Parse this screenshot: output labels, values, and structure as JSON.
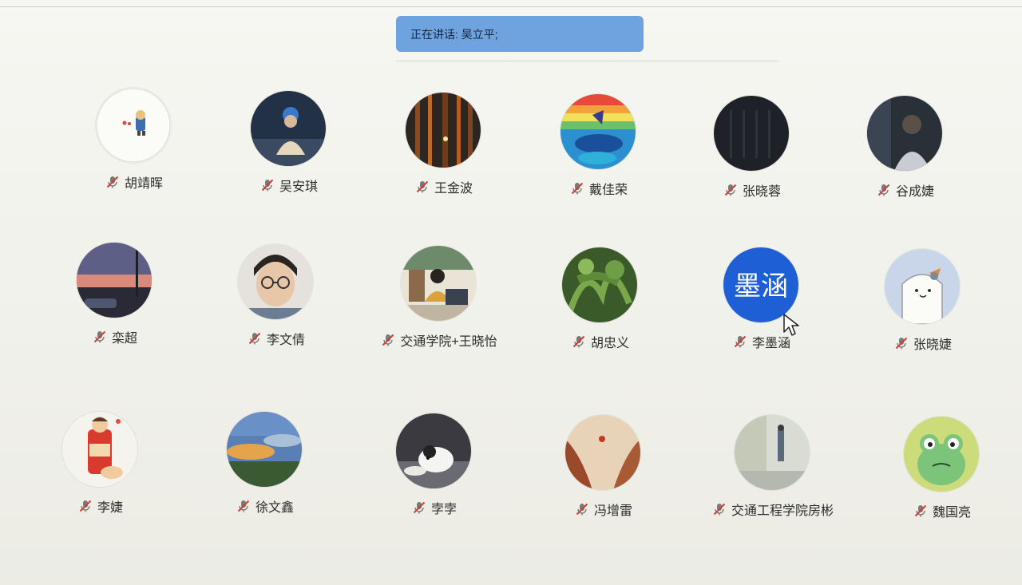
{
  "speaker_banner": {
    "text": "正在讲话: 吴立平;"
  },
  "participants": [
    {
      "name": "胡靖晖",
      "avatar_icon": "sticker-avatar",
      "mic_icon": "mic-off-icon"
    },
    {
      "name": "吴安琪",
      "avatar_icon": "photo-person-avatar",
      "mic_icon": "mic-off-icon"
    },
    {
      "name": "王金波",
      "avatar_icon": "photo-forest-avatar",
      "mic_icon": "mic-off-icon"
    },
    {
      "name": "戴佳荣",
      "avatar_icon": "illustration-whale-avatar",
      "mic_icon": "mic-off-icon"
    },
    {
      "name": "张晓蓉",
      "avatar_icon": "dark-pattern-avatar",
      "mic_icon": "mic-off-icon"
    },
    {
      "name": "谷成婕",
      "avatar_icon": "photo-person-avatar",
      "mic_icon": "mic-off-icon"
    },
    {
      "name": "栾超",
      "avatar_icon": "photo-sunset-avatar",
      "mic_icon": "mic-off-icon"
    },
    {
      "name": "李文倩",
      "avatar_icon": "photo-person-glasses-avatar",
      "mic_icon": "mic-off-icon"
    },
    {
      "name": "交通学院+王晓怡",
      "avatar_icon": "photo-study-avatar",
      "mic_icon": "mic-off-icon"
    },
    {
      "name": "胡忠义",
      "avatar_icon": "photo-plant-avatar",
      "mic_icon": "mic-off-icon"
    },
    {
      "name": "李墨涵",
      "avatar_icon": "text-avatar",
      "avatar_text": "墨涵",
      "mic_icon": "mic-off-icon"
    },
    {
      "name": "张晓婕",
      "avatar_icon": "cartoon-cat-avatar",
      "mic_icon": "mic-off-icon"
    },
    {
      "name": "李婕",
      "avatar_icon": "sticker-can-avatar",
      "mic_icon": "mic-off-icon"
    },
    {
      "name": "徐文鑫",
      "avatar_icon": "photo-sky-avatar",
      "mic_icon": "mic-off-icon"
    },
    {
      "name": "孛孛",
      "avatar_icon": "photo-dog-avatar",
      "mic_icon": "mic-off-icon"
    },
    {
      "name": "冯增雷",
      "avatar_icon": "photo-canyon-avatar",
      "mic_icon": "mic-off-icon"
    },
    {
      "name": "交通工程学院房彬",
      "avatar_icon": "photo-street-avatar",
      "mic_icon": "mic-off-icon"
    },
    {
      "name": "魏国亮",
      "avatar_icon": "cartoon-frog-avatar",
      "mic_icon": "mic-off-icon"
    }
  ],
  "colors": {
    "banner_bg": "#6fa3e0",
    "mic_off": "#c8403a",
    "text_avatar_bg": "#1f5fd6"
  }
}
